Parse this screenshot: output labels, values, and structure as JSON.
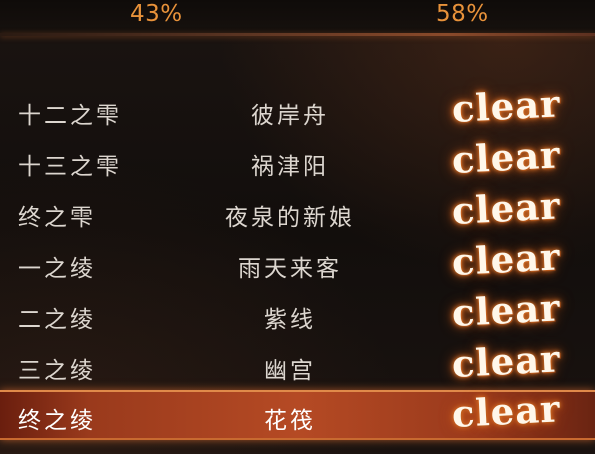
{
  "header": {
    "percent_left": "43%",
    "percent_right": "58%"
  },
  "rows": [
    {
      "name": "十二之雫",
      "title": "彼岸舟",
      "status": "clear",
      "selected": false
    },
    {
      "name": "十三之雫",
      "title": "祸津阳",
      "status": "clear",
      "selected": false
    },
    {
      "name": "终之雫",
      "title": "夜泉的新娘",
      "status": "clear",
      "selected": false
    },
    {
      "name": "一之绫",
      "title": "雨天来客",
      "status": "clear",
      "selected": false
    },
    {
      "name": "二之绫",
      "title": "紫线",
      "status": "clear",
      "selected": false
    },
    {
      "name": "三之绫",
      "title": "幽宫",
      "status": "clear",
      "selected": false
    },
    {
      "name": "终之绫",
      "title": "花筏",
      "status": "clear",
      "selected": true
    }
  ],
  "colors": {
    "percent": "#e8923a",
    "highlight": "#b54a24",
    "glow": "#e07a2a"
  }
}
